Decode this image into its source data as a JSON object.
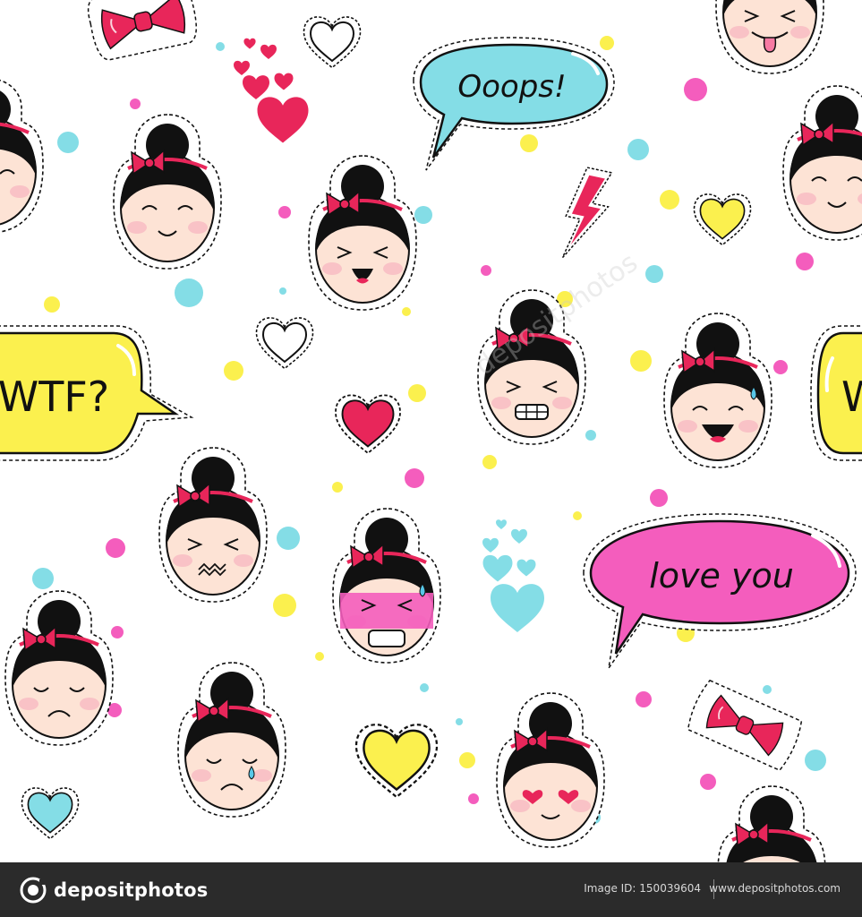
{
  "bubbles": {
    "oops": "Ooops!",
    "wtf": "WTF?",
    "wtf_partial": "W",
    "love": "love you"
  },
  "watermark": "depositphotos",
  "footer": {
    "brand": "depositphotos",
    "image_id": "Image ID: 150039604",
    "site": "www.depositphotos.com",
    "background": "#2b2b2b"
  },
  "palette": {
    "skin": "#fde3d5",
    "hair": "#111111",
    "bow": "#e8265a",
    "pink": "#f45dbd",
    "cyan": "#84dde6",
    "yellow": "#fbf04e",
    "heart_red": "#e8265a"
  },
  "icons": [
    "girl-emoji-icon",
    "heart-icon",
    "bow-icon",
    "lightning-icon",
    "speech-bubble-icon",
    "confetti-dot-icon"
  ]
}
